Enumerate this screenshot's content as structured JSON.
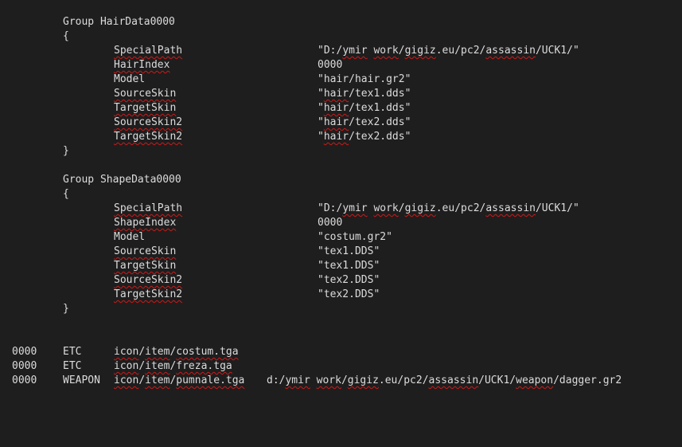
{
  "editor": {
    "hair_group": {
      "header": "Group HairData0000",
      "open_brace": "{",
      "close_brace": "}",
      "rows": [
        {
          "key": "SpecialPath",
          "val_parts": [
            "\"D:/",
            "ymir",
            " ",
            "work",
            "/",
            "gigiz",
            ".eu/pc2/",
            "assassin",
            "/UCK1/\""
          ]
        },
        {
          "key": "HairIndex",
          "val_parts": [
            "0000"
          ]
        },
        {
          "key": "Model",
          "val_parts": [
            "\"hair/hair.gr2\""
          ]
        },
        {
          "key": "SourceSkin",
          "val_parts": [
            "\"",
            "hair",
            "/tex1.dds\""
          ]
        },
        {
          "key": "TargetSkin",
          "val_parts": [
            "\"",
            "hair",
            "/tex1.dds\""
          ]
        },
        {
          "key": "SourceSkin2",
          "val_parts": [
            "\"",
            "hair",
            "/tex2.dds\""
          ]
        },
        {
          "key": "TargetSkin2",
          "val_parts": [
            "\"",
            "hair",
            "/tex2.dds\""
          ]
        }
      ]
    },
    "shape_group": {
      "header": "Group ShapeData0000",
      "open_brace": "{",
      "close_brace": "}",
      "rows": [
        {
          "key": "SpecialPath",
          "val_parts": [
            "\"D:/",
            "ymir",
            " ",
            "work",
            "/",
            "gigiz",
            ".eu/pc2/",
            "assassin",
            "/UCK1/\""
          ]
        },
        {
          "key": "ShapeIndex",
          "val_parts": [
            "0000"
          ]
        },
        {
          "key": "Model",
          "val_parts": [
            "\"costum.gr2\""
          ]
        },
        {
          "key": "SourceSkin",
          "val_parts": [
            "\"tex1.DDS\""
          ]
        },
        {
          "key": "TargetSkin",
          "val_parts": [
            "\"tex1.DDS\""
          ]
        },
        {
          "key": "SourceSkin2",
          "val_parts": [
            "\"tex2.DDS\""
          ]
        },
        {
          "key": "TargetSkin2",
          "val_parts": [
            "\"tex2.DDS\""
          ]
        }
      ]
    },
    "item_rows": [
      {
        "index": "0000",
        "type": "ETC",
        "icon_parts": [
          "icon",
          "/",
          "item",
          "/",
          "costum.tga"
        ],
        "model_parts": []
      },
      {
        "index": "0000",
        "type": "ETC",
        "icon_parts": [
          "icon",
          "/",
          "item",
          "/",
          "freza.tga"
        ],
        "model_parts": []
      },
      {
        "index": "0000",
        "type": "WEAPON",
        "icon_parts": [
          "icon",
          "/",
          "item",
          "/",
          "pumnale.tga"
        ],
        "model_parts": [
          "d:/",
          "ymir",
          " ",
          "work",
          "/",
          "gigiz",
          ".eu/pc2/",
          "assassin",
          "/UCK1/",
          "weapon",
          "/dagger.gr2"
        ]
      }
    ]
  }
}
